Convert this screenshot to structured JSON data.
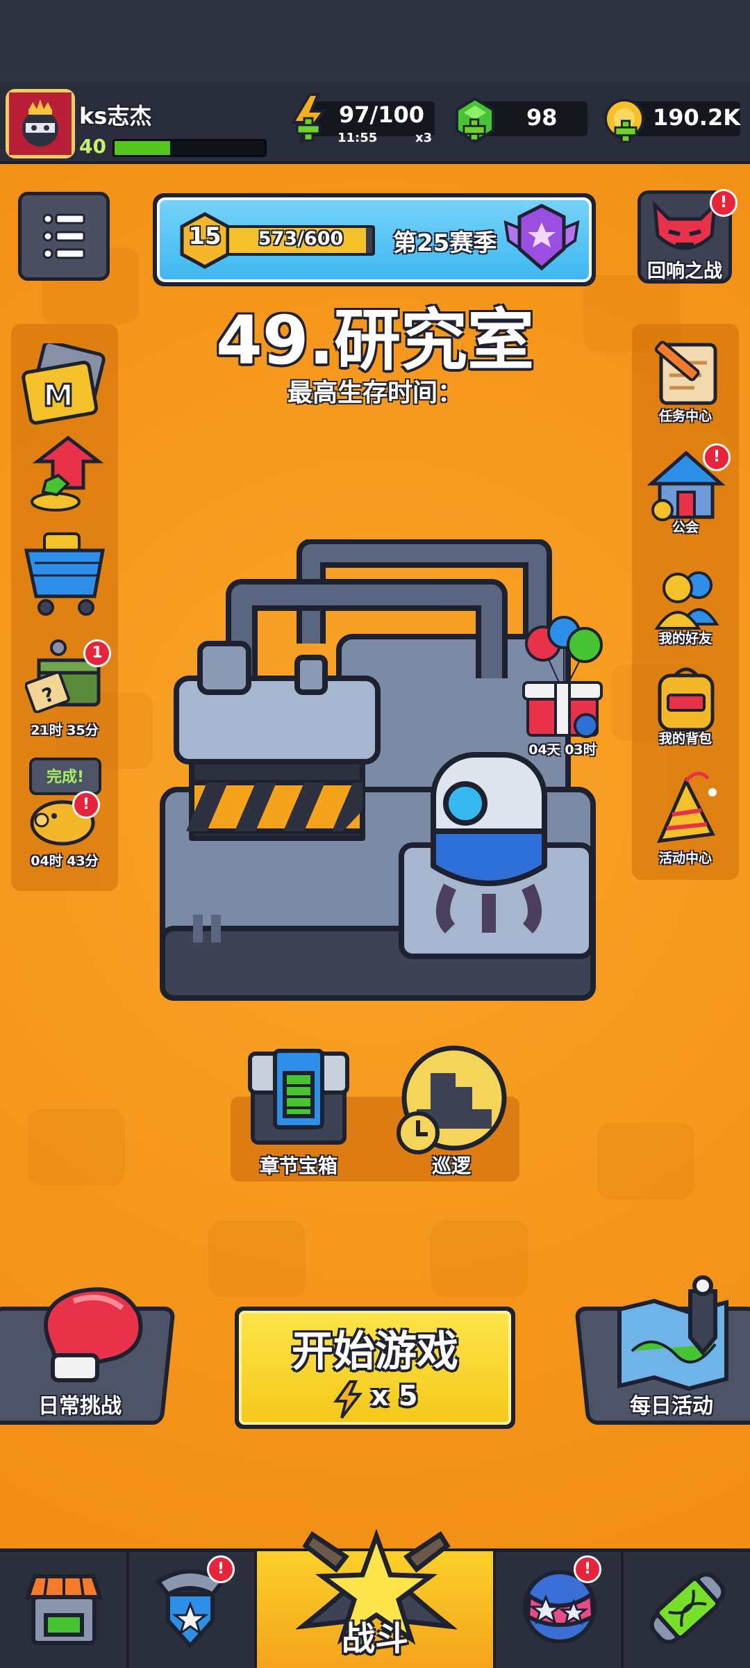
{
  "player": {
    "name": "ks志杰",
    "level": "40",
    "xp_fraction": 0.37
  },
  "resources": {
    "energy_value": "97/100",
    "energy_timer": "11:55",
    "energy_multiplier": "x3",
    "gems": "98",
    "coins": "190.2K"
  },
  "season": {
    "level": "15",
    "progress_text": "573/600",
    "progress_fraction": 0.955,
    "label": "第25赛季"
  },
  "echo_battle": {
    "label": "回响之战"
  },
  "stage": {
    "title": "49.研究室",
    "subtitle": "最高生存时间："
  },
  "left_sidebar": {
    "chest_timer": "21时 35分",
    "chest_badge": "1",
    "piggy_bubble": "完成!",
    "piggy_timer": "04时 43分"
  },
  "right_sidebar": {
    "items": [
      {
        "label": "任务中心"
      },
      {
        "label": "公会"
      },
      {
        "label": "我的好友"
      },
      {
        "label": "我的背包"
      },
      {
        "label": "活动中心"
      }
    ]
  },
  "gift_timer": "04天 03时",
  "chapter_chest_label": "章节宝箱",
  "patrol_label": "巡逻",
  "daily_challenge_label": "日常挑战",
  "start_button": {
    "label": "开始游戏",
    "cost": "x 5"
  },
  "daily_activity_label": "每日活动",
  "bottom_nav": {
    "battle_label": "战斗"
  },
  "colors": {
    "background": "#f59a1c",
    "start_button": "#f7d21e",
    "badge": "#e8243a",
    "season_panel": "#3fb8f0"
  }
}
